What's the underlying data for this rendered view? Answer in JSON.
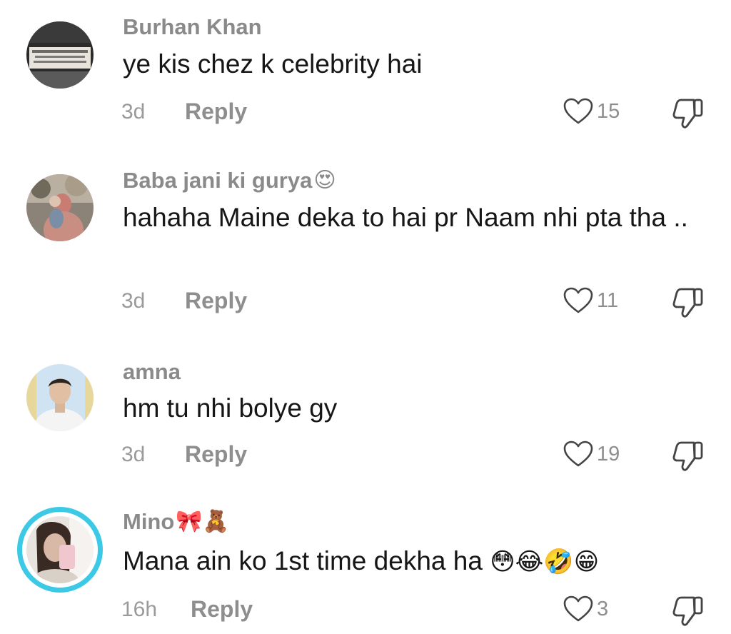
{
  "comments": [
    {
      "username": "Burhan Khan",
      "username_emoji": "",
      "text": "ye kis chez k celebrity hai",
      "text_emoji": "",
      "time": "3d",
      "reply_label": "Reply",
      "likes": "15"
    },
    {
      "username": "Baba jani ki gurya",
      "username_emoji": "😍",
      "text": "hahaha Maine deka to hai pr Naam nhi pta tha ..",
      "text_emoji": "",
      "time": "3d",
      "reply_label": "Reply",
      "likes": "11"
    },
    {
      "username": "amna",
      "username_emoji": "",
      "text": "hm tu nhi bolye gy",
      "text_emoji": "",
      "time": "3d",
      "reply_label": "Reply",
      "likes": "19"
    },
    {
      "username": "Mino",
      "username_emoji": "🎀🧸",
      "text": "Mana ain ko 1st time dekha ha",
      "text_emoji": "😳😂🤣😁",
      "time": "16h",
      "reply_label": "Reply",
      "likes": "3"
    }
  ],
  "icons": {
    "like": "heart-outline-icon",
    "dislike": "thumbs-down-outline-icon"
  },
  "colors": {
    "username": "#8a8a8a",
    "text": "#161616",
    "meta": "#8e8e8e",
    "story_ring": "#3cc9e6"
  }
}
